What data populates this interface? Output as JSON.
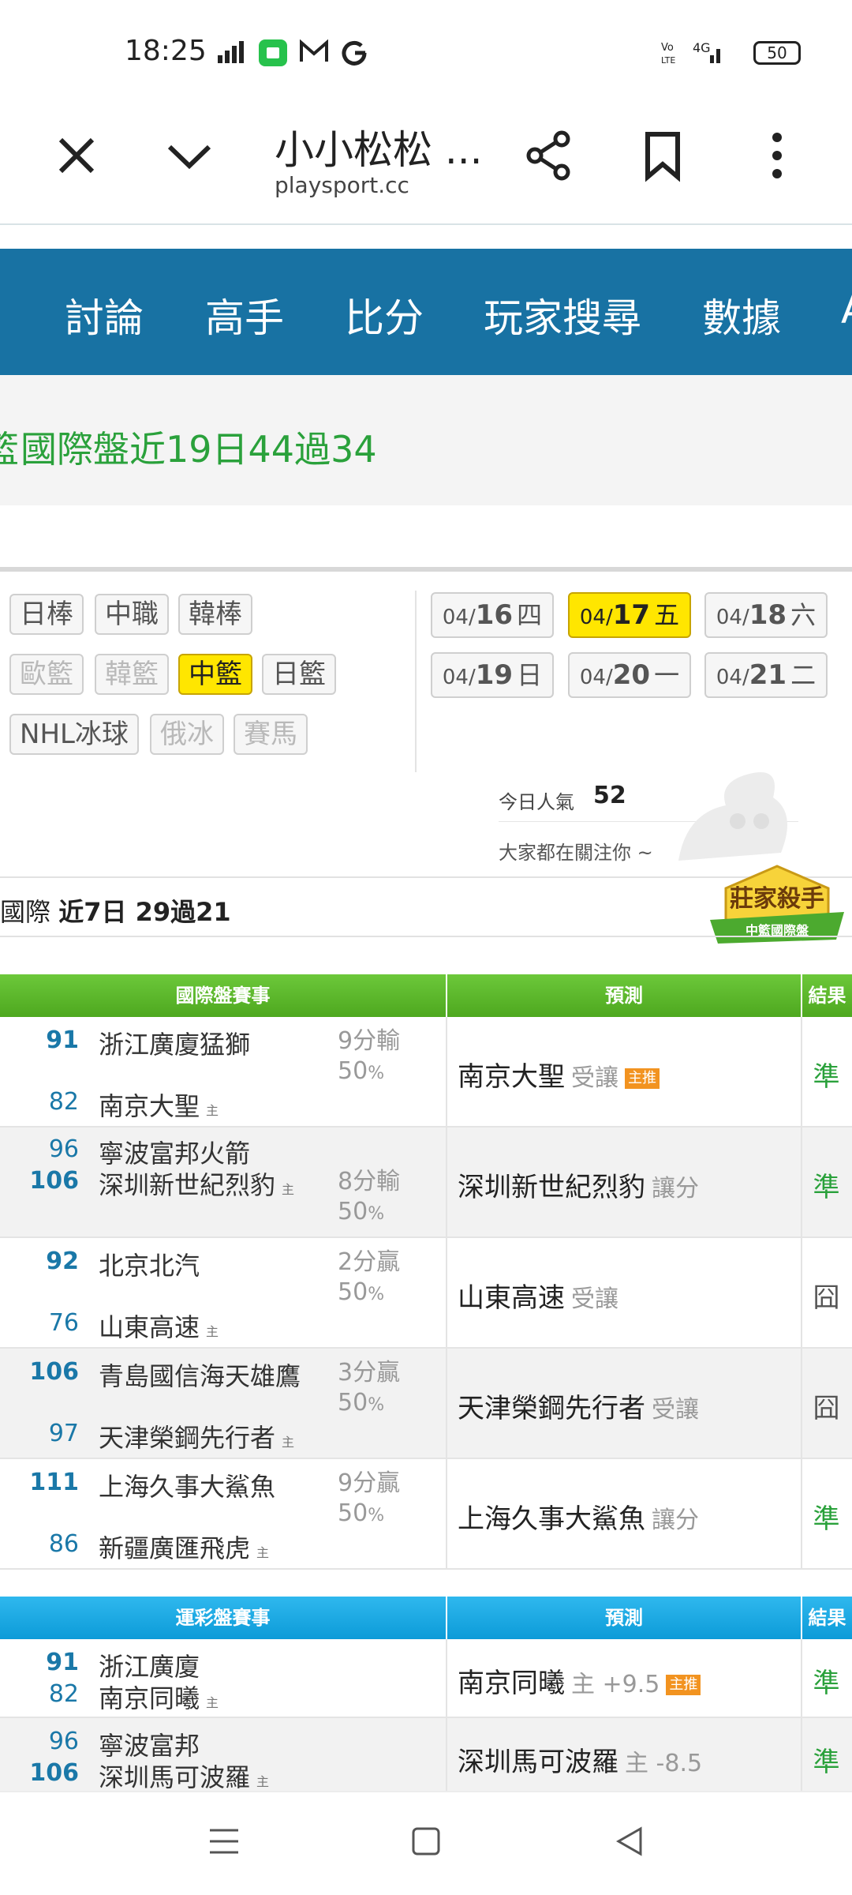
{
  "status_bar": {
    "time": "18:25",
    "battery": "50",
    "net": "4G"
  },
  "browser": {
    "title": "小小松松 ...",
    "url": "playsport.cc"
  },
  "nav": [
    "討論",
    "高手",
    "比分",
    "玩家搜尋",
    "數據",
    "A"
  ],
  "banner": {
    "prefix": "籃",
    "text": "國際盤近19日44過34"
  },
  "sports": [
    {
      "label": "日棒",
      "state": "normal"
    },
    {
      "label": "中職",
      "state": "normal"
    },
    {
      "label": "韓棒",
      "state": "normal"
    },
    {
      "label": "歐籃",
      "state": "dim"
    },
    {
      "label": "韓籃",
      "state": "dim"
    },
    {
      "label": "中籃",
      "state": "active"
    },
    {
      "label": "日籃",
      "state": "normal"
    },
    {
      "label": "NHL冰球",
      "state": "normal"
    },
    {
      "label": "俄冰",
      "state": "dim"
    },
    {
      "label": "賽馬",
      "state": "dim"
    }
  ],
  "dates": [
    {
      "pre": "04/",
      "day": "16",
      "wd": "四",
      "active": false
    },
    {
      "pre": "04/",
      "day": "17",
      "wd": "五",
      "active": true
    },
    {
      "pre": "04/",
      "day": "18",
      "wd": "六",
      "active": false
    },
    {
      "pre": "04/",
      "day": "19",
      "wd": "日",
      "active": false
    },
    {
      "pre": "04/",
      "day": "20",
      "wd": "一",
      "active": false
    },
    {
      "pre": "04/",
      "day": "21",
      "wd": "二",
      "active": false
    }
  ],
  "popularity": {
    "label": "今日人氣",
    "value": "52",
    "sub": "大家都在關注你 ~"
  },
  "badge": {
    "title": "莊家殺手",
    "sub": "中籃國際盤"
  },
  "record": {
    "prefix": "國際",
    "text": "近7日 29過21"
  },
  "international_table": {
    "headers": [
      "國際盤賽事",
      "預測",
      "結果"
    ],
    "rows": [
      {
        "s1": "91",
        "t1": "浙江廣廈猛獅",
        "s2": "82",
        "t2": "南京大聖",
        "win": 1,
        "note1": "9分輸",
        "note2": "50",
        "pred": "南京大聖",
        "pred_sub": "受讓",
        "tag": "主推",
        "result": "準",
        "ok": true
      },
      {
        "s1": "96",
        "t1": "寧波富邦火箭",
        "s2": "106",
        "t2": "深圳新世紀烈豹",
        "win": 2,
        "note1": "8分輸",
        "note2": "50",
        "pred": "深圳新世紀烈豹",
        "pred_sub": "讓分",
        "tag": "",
        "result": "準",
        "ok": true
      },
      {
        "s1": "92",
        "t1": "北京北汽",
        "s2": "76",
        "t2": "山東高速",
        "win": 1,
        "note1": "2分贏",
        "note2": "50",
        "pred": "山東高速",
        "pred_sub": "受讓",
        "tag": "",
        "result": "囧",
        "ok": false
      },
      {
        "s1": "106",
        "t1": "青島國信海天雄鷹",
        "s2": "97",
        "t2": "天津榮鋼先行者",
        "win": 1,
        "note1": "3分贏",
        "note2": "50",
        "pred": "天津榮鋼先行者",
        "pred_sub": "受讓",
        "tag": "",
        "result": "囧",
        "ok": false
      },
      {
        "s1": "111",
        "t1": "上海久事大鯊魚",
        "s2": "86",
        "t2": "新疆廣匯飛虎",
        "win": 1,
        "note1": "9分贏",
        "note2": "50",
        "pred": "上海久事大鯊魚",
        "pred_sub": "讓分",
        "tag": "",
        "result": "準",
        "ok": true
      }
    ]
  },
  "sports_lottery_table": {
    "headers": [
      "運彩盤賽事",
      "預測",
      "結果"
    ],
    "rows": [
      {
        "s1": "91",
        "t1": "浙江廣廈",
        "s2": "82",
        "t2": "南京同曦",
        "win": 1,
        "pred": "南京同曦",
        "pred_sub": "主 +9.5",
        "tag": "主推",
        "result": "準",
        "ok": true
      },
      {
        "s1": "96",
        "t1": "寧波富邦",
        "s2": "106",
        "t2": "深圳馬可波羅",
        "win": 2,
        "pred": "深圳馬可波羅",
        "pred_sub": "主 -8.5",
        "tag": "",
        "result": "準",
        "ok": true
      }
    ]
  },
  "home_mark": "主",
  "pct_sign": "%",
  "colors": {
    "nav": "#1872a3",
    "green_head": "#5cb82a",
    "blue_head": "#13a6e0",
    "accent_yellow": "#ffe600",
    "ok_green": "#2aa13b"
  }
}
